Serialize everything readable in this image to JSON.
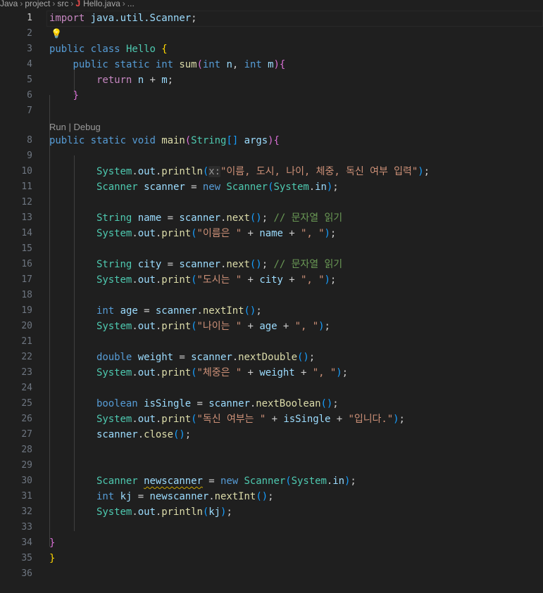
{
  "breadcrumb": {
    "items": [
      "Java",
      "project",
      "src",
      "Hello.java",
      "..."
    ],
    "file_icon": "J"
  },
  "editor": {
    "line_numbers": [
      "1",
      "2",
      "3",
      "4",
      "5",
      "6",
      "7",
      "8",
      "9",
      "10",
      "11",
      "12",
      "13",
      "14",
      "15",
      "16",
      "17",
      "18",
      "19",
      "20",
      "21",
      "22",
      "23",
      "24",
      "25",
      "26",
      "27",
      "28",
      "29",
      "30",
      "31",
      "32",
      "33",
      "34",
      "35",
      "36"
    ],
    "codelens": {
      "run": "Run",
      "separator": " | ",
      "debug": "Debug"
    },
    "inlay_hint": "x:",
    "lightbulb": "lightbulb-icon",
    "tokens": {
      "import": "import",
      "scanner_import": "java.util.Scanner",
      "semi": ";",
      "public": "public",
      "class": "class",
      "hello": "Hello",
      "static": "static",
      "int": "int",
      "sum": "sum",
      "n": "n",
      "m": "m",
      "return": "return",
      "void": "void",
      "main": "main",
      "string_type": "String",
      "args": "args",
      "system": "System",
      "out": "out",
      "println": "println",
      "print": "print",
      "scanner_type": "Scanner",
      "scanner_var": "scanner",
      "new": "new",
      "in": "in",
      "name": "name",
      "next": "next",
      "city": "city",
      "age": "age",
      "nextInt": "nextInt",
      "double": "double",
      "weight": "weight",
      "nextDouble": "nextDouble",
      "boolean": "boolean",
      "isSingle": "isSingle",
      "nextBoolean": "nextBoolean",
      "close": "close",
      "newscanner": "newscanner",
      "kj": "kj",
      "s_prompt": "\"이름, 도시, 나이, 체중, 독신 여부 입력\"",
      "c_read": "// 문자열 읽기",
      "s_name": "\"이름은 \"",
      "s_comma": "\", \"",
      "s_city": "\"도시는 \"",
      "s_age": "\"나이는 \"",
      "s_weight": "\"체중은 \"",
      "s_single": "\"독신 여부는 \"",
      "s_end": "\"입니다.\""
    }
  }
}
